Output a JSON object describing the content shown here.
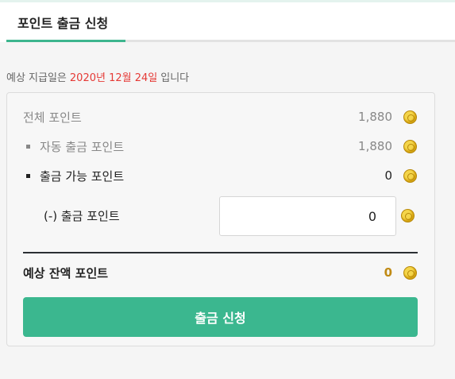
{
  "header": {
    "tab_label": "포인트 출금 신청"
  },
  "notice": {
    "prefix": "예상 지급일은",
    "date": "2020년 12월 24일",
    "suffix": "입니다"
  },
  "points": {
    "total": {
      "label": "전체 포인트",
      "value": "1,880",
      "icon": "coin-icon"
    },
    "auto_withdraw": {
      "label": "자동 출금 포인트",
      "value": "1,880",
      "icon": "coin-icon"
    },
    "available": {
      "label": "출금 가능 포인트",
      "value": "0",
      "icon": "coin-icon"
    },
    "withdraw": {
      "label": "(-) 출금 포인트",
      "input_value": "0",
      "icon": "coin-icon"
    },
    "balance": {
      "label": "예상 잔액 포인트",
      "value": "0",
      "icon": "coin-icon"
    }
  },
  "submit_label": "출금 신청",
  "colors": {
    "accent": "#3bb78f",
    "date_red": "#e53935",
    "balance_gold": "#c08a14",
    "coin_gold": "#d9a914"
  }
}
